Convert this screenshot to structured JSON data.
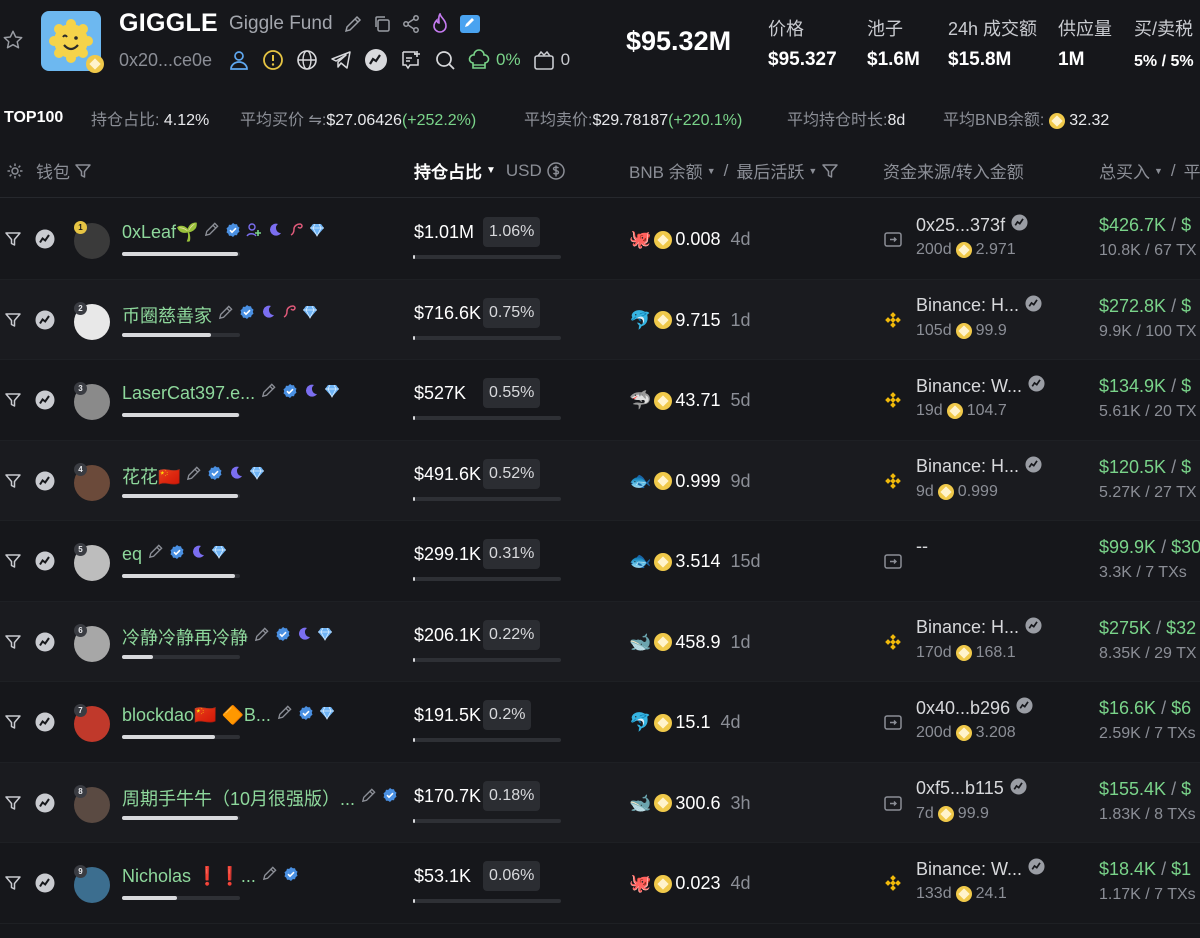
{
  "header": {
    "symbol": "GIGGLE",
    "name": "Giggle Fund",
    "address": "0x20...ce0e",
    "holders_pct": "0%",
    "count": "0",
    "market_cap": "$95.32M",
    "stats": [
      {
        "label": "价格",
        "value": "$95.327"
      },
      {
        "label": "池子",
        "value": "$1.6M"
      },
      {
        "label": "24h 成交额",
        "value": "$15.8M"
      },
      {
        "label": "供应量",
        "value": "1M"
      },
      {
        "label": "买/卖税",
        "value": "5%  /  5%"
      }
    ]
  },
  "summary": {
    "tag": "TOP100",
    "hold_ratio_label": "持仓占比:",
    "hold_ratio_value": "4.12%",
    "avg_buy_label": "平均买价 ⇋:",
    "avg_buy_value": "$27.06426",
    "avg_buy_change": "(+252.2%)",
    "avg_sell_label": "平均卖价:",
    "avg_sell_value": "$29.78187",
    "avg_sell_change": "(+220.1%)",
    "avg_hold_label": "平均持仓时长:",
    "avg_hold_value": "8d",
    "avg_bnb_label": "平均BNB余额:",
    "avg_bnb_value": "32.32"
  },
  "columns": {
    "wallet": "钱包",
    "hold_ratio": "持仓占比",
    "usd": "USD",
    "bnb_balance": "BNB 余额",
    "slash": "/",
    "last_active": "最后活跃",
    "source": "资金来源/转入金额",
    "total_buy": "总买入",
    "avg_cut": "平"
  },
  "rows": [
    {
      "rank": "1",
      "name": "0xLeaf🌱",
      "bar": 0.98,
      "hold": "$1.01M",
      "pct": "1.06%",
      "tier": "🐙",
      "bnb": "0.008",
      "active": "4d",
      "src_type": "wallet",
      "src_name": "0x25...373f",
      "src_age": "200d",
      "src_amt": "2.971",
      "buy": "$426.7K",
      "buy_cut": "$",
      "buy_sub": "10.8K / 67 TX"
    },
    {
      "rank": "2",
      "name": "币圈慈善家",
      "bar": 0.75,
      "hold": "$716.6K",
      "pct": "0.75%",
      "tier": "🐬",
      "bnb": "9.715",
      "active": "1d",
      "src_type": "binance",
      "src_name": "Binance: H...",
      "src_age": "105d",
      "src_amt": "99.9",
      "buy": "$272.8K",
      "buy_cut": "$",
      "buy_sub": "9.9K / 100 TX"
    },
    {
      "rank": "3",
      "name": "LaserCat397.e...",
      "bar": 0.99,
      "hold": "$527K",
      "pct": "0.55%",
      "tier": "🦈",
      "bnb": "43.71",
      "active": "5d",
      "src_type": "binance",
      "src_name": "Binance: W...",
      "src_age": "19d",
      "src_amt": "104.7",
      "buy": "$134.9K",
      "buy_cut": "$",
      "buy_sub": "5.61K / 20 TX"
    },
    {
      "rank": "4",
      "name": "花花🇨🇳",
      "bar": 0.98,
      "hold": "$491.6K",
      "pct": "0.52%",
      "tier": "🐟",
      "bnb": "0.999",
      "active": "9d",
      "src_type": "binance",
      "src_name": "Binance: H...",
      "src_age": "9d",
      "src_amt": "0.999",
      "buy": "$120.5K",
      "buy_cut": "$",
      "buy_sub": "5.27K / 27 TX"
    },
    {
      "rank": "5",
      "name": "eq",
      "bar": 0.96,
      "hold": "$299.1K",
      "pct": "0.31%",
      "tier": "🐟",
      "bnb": "3.514",
      "active": "15d",
      "src_type": "wallet",
      "src_name": "--",
      "src_age": "",
      "src_amt": "",
      "buy": "$99.9K",
      "buy_cut": "$30",
      "buy_sub": "3.3K / 7 TXs"
    },
    {
      "rank": "6",
      "name": "冷静冷静再冷静",
      "bar": 0.26,
      "hold": "$206.1K",
      "pct": "0.22%",
      "tier": "🐋",
      "bnb": "458.9",
      "active": "1d",
      "src_type": "binance",
      "src_name": "Binance: H...",
      "src_age": "170d",
      "src_amt": "168.1",
      "buy": "$275K",
      "buy_cut": "$32",
      "buy_sub": "8.35K / 29 TX"
    },
    {
      "rank": "7",
      "name": "blockdao🇨🇳 🔶B...",
      "bar": 0.79,
      "hold": "$191.5K",
      "pct": "0.2%",
      "tier": "🐬",
      "bnb": "15.1",
      "active": "4d",
      "src_type": "wallet",
      "src_name": "0x40...b296",
      "src_age": "200d",
      "src_amt": "3.208",
      "buy": "$16.6K",
      "buy_cut": "$6",
      "buy_sub": "2.59K / 7 TXs"
    },
    {
      "rank": "8",
      "name": "周期手牛牛（10月很强版）...",
      "bar": 0.98,
      "hold": "$170.7K",
      "pct": "0.18%",
      "tier": "🐋",
      "bnb": "300.6",
      "active": "3h",
      "src_type": "wallet",
      "src_name": "0xf5...b115",
      "src_age": "7d",
      "src_amt": "99.9",
      "buy": "$155.4K",
      "buy_cut": "$",
      "buy_sub": "1.83K / 8 TXs"
    },
    {
      "rank": "9",
      "name": "Nicholas ❗❗...",
      "bar": 0.47,
      "hold": "$53.1K",
      "pct": "0.06%",
      "tier": "🐙",
      "bnb": "0.023",
      "active": "4d",
      "src_type": "binance",
      "src_name": "Binance: W...",
      "src_age": "133d",
      "src_amt": "24.1",
      "buy": "$18.4K",
      "buy_cut": "$1",
      "buy_sub": "1.17K / 7 TXs"
    }
  ],
  "colors": {
    "accent_green": "#7ad48a",
    "wallet_green": "#8ed89c",
    "binance_yellow": "#f0b90b",
    "bnb_coin": "#f0c94a",
    "background": "#16171b"
  }
}
